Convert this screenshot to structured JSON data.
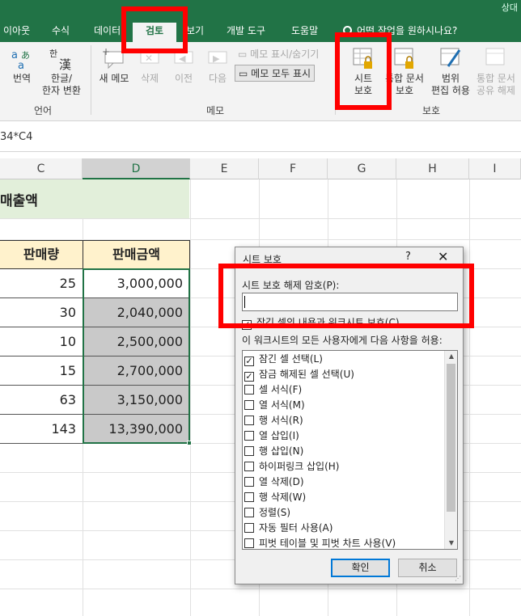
{
  "window": {
    "user_name": "상대"
  },
  "tabs": [
    {
      "label": "이아웃"
    },
    {
      "label": "수식"
    },
    {
      "label": "데이터"
    },
    {
      "label": "검토"
    },
    {
      "label": "보기"
    },
    {
      "label": "개발 도구"
    },
    {
      "label": "도움말"
    }
  ],
  "tell_me": "어떤 작업을 원하시나요?",
  "ribbon": {
    "translate": "번역",
    "hanja_line1": "한글/",
    "hanja_line2": "한자 변환",
    "group_language": "언어",
    "new_memo": "새 메모",
    "delete": "삭제",
    "previous": "이전",
    "next": "다음",
    "show_hide_memo": "메모 표시/숨기기",
    "show_all_memos": "메모 모두 표시",
    "group_memo": "메모",
    "protect_sheet_line1": "시트",
    "protect_sheet_line2": "보호",
    "protect_workbook_line1": "통합 문서",
    "protect_workbook_line2": "보호",
    "allow_edit_line1": "범위",
    "allow_edit_line2": "편집 허용",
    "unshare_line1": "통합 문서",
    "unshare_line2": "공유 해제",
    "group_protect": "보호"
  },
  "formula_bar": {
    "text": "34*C4"
  },
  "columns": [
    "C",
    "D",
    "E",
    "F",
    "G",
    "H",
    "I"
  ],
  "sheet": {
    "title": "매출액",
    "header_qty": "판매량",
    "header_amount": "판매금액",
    "rows": [
      {
        "qty": "25",
        "amount": "3,000,000"
      },
      {
        "qty": "30",
        "amount": "2,040,000"
      },
      {
        "qty": "10",
        "amount": "2,500,000"
      },
      {
        "qty": "15",
        "amount": "2,700,000"
      },
      {
        "qty": "63",
        "amount": "3,150,000"
      },
      {
        "qty": "143",
        "amount": "13,390,000"
      }
    ]
  },
  "dialog": {
    "title": "시트 보호",
    "help": "?",
    "close": "✕",
    "password_label": "시트 보호 해제 암호(P):",
    "password_value": "",
    "protect_contents_label": "잠긴 셀의 내용과 워크시트 보호(C)",
    "allow_label": "이 워크시트의 모든 사용자에게 다음 사항을 허용:",
    "options": [
      {
        "label": "잠긴 셀 선택(L)",
        "checked": true
      },
      {
        "label": "잠금 해제된 셀 선택(U)",
        "checked": true
      },
      {
        "label": "셀 서식(F)",
        "checked": false
      },
      {
        "label": "열 서식(M)",
        "checked": false
      },
      {
        "label": "행 서식(R)",
        "checked": false
      },
      {
        "label": "열 삽입(I)",
        "checked": false
      },
      {
        "label": "행 삽입(N)",
        "checked": false
      },
      {
        "label": "하이퍼링크 삽입(H)",
        "checked": false
      },
      {
        "label": "열 삭제(D)",
        "checked": false
      },
      {
        "label": "행 삭제(W)",
        "checked": false
      },
      {
        "label": "정렬(S)",
        "checked": false
      },
      {
        "label": "자동 필터 사용(A)",
        "checked": false
      },
      {
        "label": "피벗 테이블 및 피벗 차트 사용(V)",
        "checked": false
      }
    ],
    "ok": "확인",
    "cancel": "취소"
  },
  "colors": {
    "accent": "#217346",
    "highlight": "#ff0000"
  }
}
